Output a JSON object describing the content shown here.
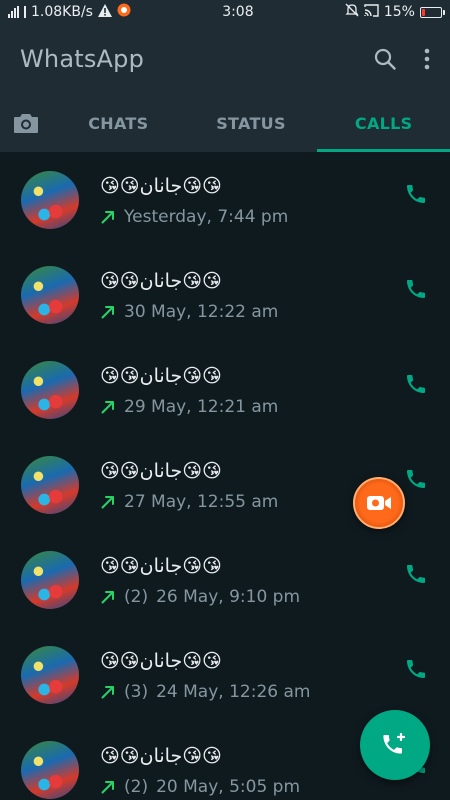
{
  "status_bar": {
    "speed": "1.08KB/s",
    "time": "3:08",
    "battery": "15%",
    "battery_level": 0.15
  },
  "app": {
    "title": "WhatsApp"
  },
  "tabs": [
    {
      "label": "CHATS",
      "active": false
    },
    {
      "label": "STATUS",
      "active": false
    },
    {
      "label": "CALLS",
      "active": true
    }
  ],
  "calls": [
    {
      "name": "😘😘جانان😘😘",
      "count": "",
      "time": "Yesterday, 7:44 pm",
      "direction": "outgoing"
    },
    {
      "name": "😘😘جانان😘😘",
      "count": "",
      "time": "30 May, 12:22 am",
      "direction": "outgoing"
    },
    {
      "name": "😘😘جانان😘😘",
      "count": "",
      "time": "29 May, 12:21 am",
      "direction": "outgoing"
    },
    {
      "name": "😘😘جانان😘😘",
      "count": "",
      "time": "27 May, 12:55 am",
      "direction": "outgoing"
    },
    {
      "name": "😘😘جانان😘😘",
      "count": "(2)",
      "time": "26 May, 9:10 pm",
      "direction": "outgoing"
    },
    {
      "name": "😘😘جانان😘😘",
      "count": "(3)",
      "time": "24 May, 12:26 am",
      "direction": "outgoing"
    },
    {
      "name": "😘😘جانان😘😘",
      "count": "(2)",
      "time": "20 May, 5:05 pm",
      "direction": "outgoing"
    }
  ],
  "colors": {
    "accent": "#00a884",
    "header": "#1f2c34",
    "background": "#0f1a1f",
    "outgoing_arrow": "#25d366",
    "battery_low": "#ff3b30",
    "screen_recorder": "#ff6a1a"
  },
  "icons": {
    "search": "search-icon",
    "menu": "more-vert-icon",
    "camera": "camera-icon",
    "call": "phone-icon",
    "new_call": "add-call-icon",
    "recorder": "video-camera-icon"
  }
}
